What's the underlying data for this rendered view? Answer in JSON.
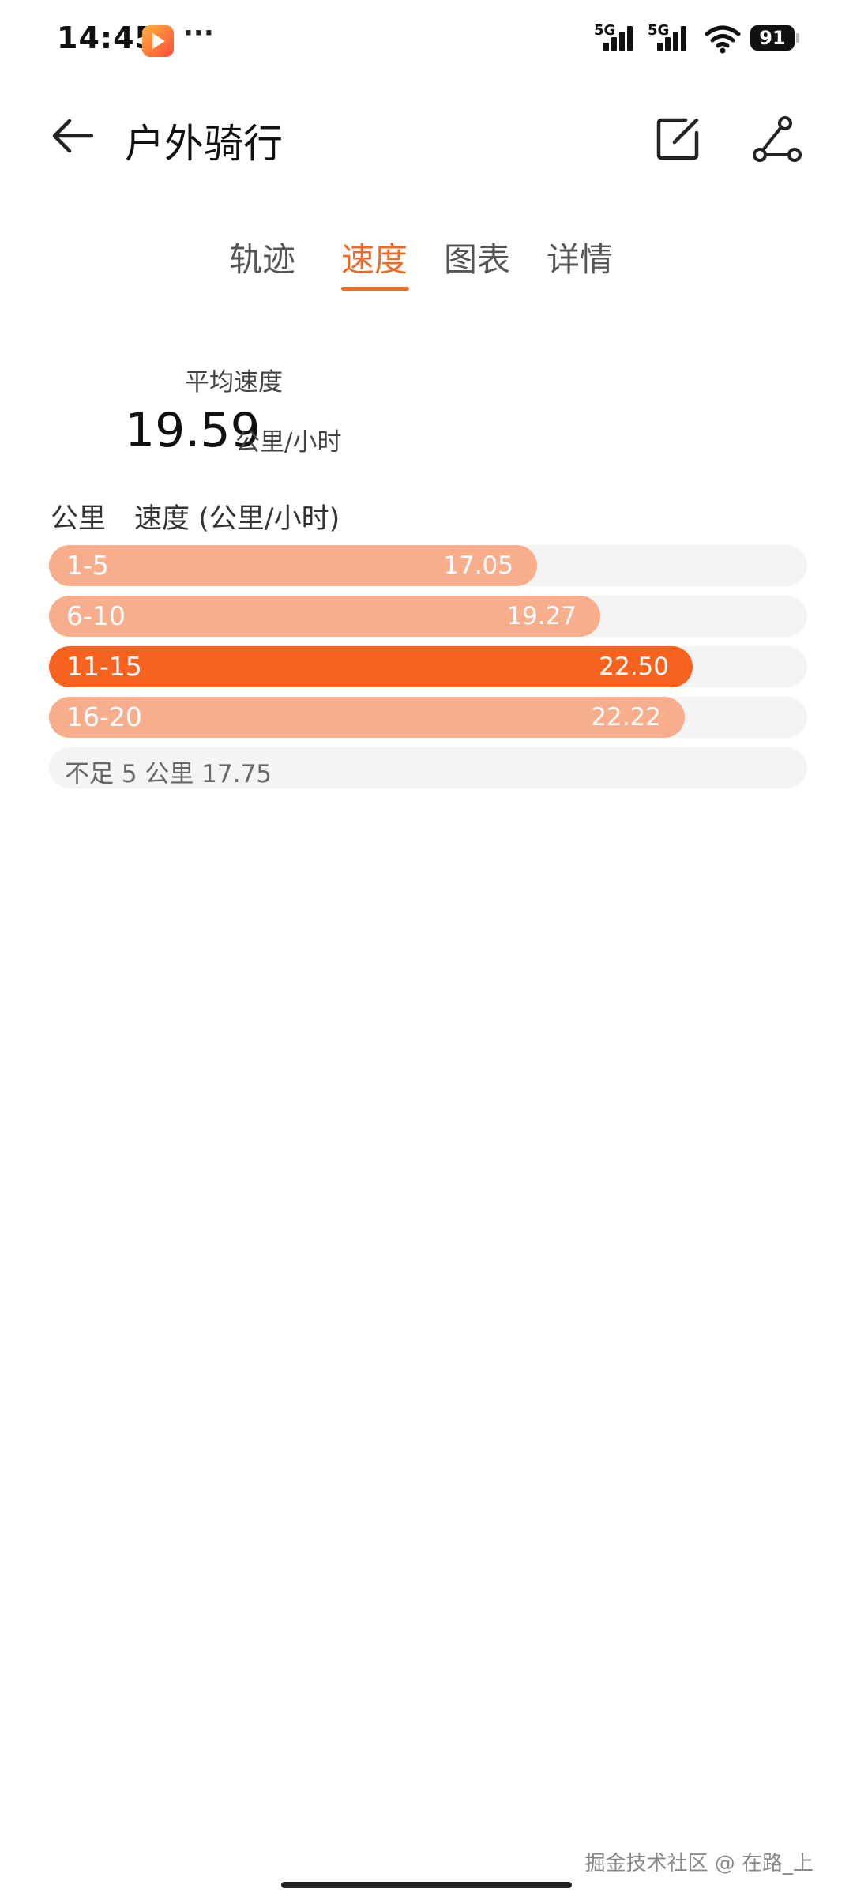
{
  "status_bar": {
    "time": "14:45",
    "more": "···",
    "signal1_label": "5G",
    "signal2_label": "5G",
    "battery": "91"
  },
  "header": {
    "title": "户外骑行"
  },
  "tabs": [
    {
      "label": "轨迹"
    },
    {
      "label": "速度"
    },
    {
      "label": "图表"
    },
    {
      "label": "详情"
    }
  ],
  "active_tab": "速度",
  "avg_speed": {
    "label": "平均速度",
    "value": "19.59",
    "unit": "公里/小时"
  },
  "table": {
    "col_km": "公里",
    "col_speed": "速度 (公里/小时)"
  },
  "chart_data": {
    "type": "bar",
    "orientation": "horizontal",
    "categories": [
      "1-5",
      "6-10",
      "11-15",
      "16-20"
    ],
    "values": [
      17.05,
      19.27,
      22.5,
      22.22
    ],
    "labels": [
      "17.05",
      "19.27",
      "22.50",
      "22.22"
    ],
    "highlight_index": 2,
    "remainder": "不足 5 公里 17.75",
    "colors": {
      "normal": "#f8ad8d",
      "highlight": "#f8621f",
      "track": "#f4f4f4"
    },
    "xlim": [
      0,
      26.5
    ]
  },
  "footer": {
    "watermark": "掘金技术社区 @ 在路_上"
  },
  "colors": {
    "accent": "#f06a26"
  }
}
